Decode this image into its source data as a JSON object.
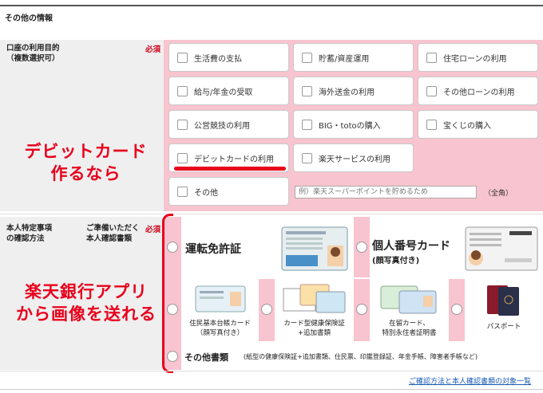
{
  "section": {
    "title": "その他の情報"
  },
  "purpose": {
    "label_line1": "口座の利用目的",
    "label_line2": "（複数選択可）",
    "required": "必須",
    "options": [
      "生活費の支払",
      "貯蓄/資産運用",
      "住宅ローンの利用",
      "給与/年金の受取",
      "海外送金の利用",
      "その他ローンの利用",
      "公営競技の利用",
      "BIG・totoの購入",
      "宝くじの購入",
      "デビットカードの利用",
      "楽天サービスの利用"
    ],
    "other_label": "その他",
    "other_placeholder": "例）楽天スーパーポイントを貯めるため",
    "zenkaku": "（全角）"
  },
  "annotations": {
    "debit_line1": "デビットカード",
    "debit_line2": "作るなら",
    "app_line1": "楽天銀行アプリ",
    "app_line2": "から画像を送れる"
  },
  "identity": {
    "label_line1": "本人特定事項",
    "label_line2": "の確認方法",
    "docs_line1": "ご準備いただく",
    "docs_line2": "本人確認書類",
    "required": "必須",
    "license": "運転免許証",
    "mynumber": "個人番号カード",
    "mynumber_sub": "(顔写真付き)",
    "juki_line1": "住民基本台帳カード",
    "juki_line2": "（顔写真付き）",
    "insurance_line1": "カード型健康保険証",
    "insurance_line2": "+追加書類",
    "residence_line1": "在留カード、",
    "residence_line2": "特別永住者証明書",
    "passport": "パスポート",
    "other_docs": "その他書類",
    "other_docs_note": "(紙型の健康保険証+追加書類、住民票、印鑑登録証、年金手帳、障害者手帳など)"
  },
  "link": {
    "label": "ご確認方法と本人確認書類の対象一覧"
  },
  "colors": {
    "accent_pink": "#f8c4cf",
    "annotation_red": "#e8001c",
    "required_red": "#d0021b",
    "link_blue": "#1a5bb5"
  }
}
